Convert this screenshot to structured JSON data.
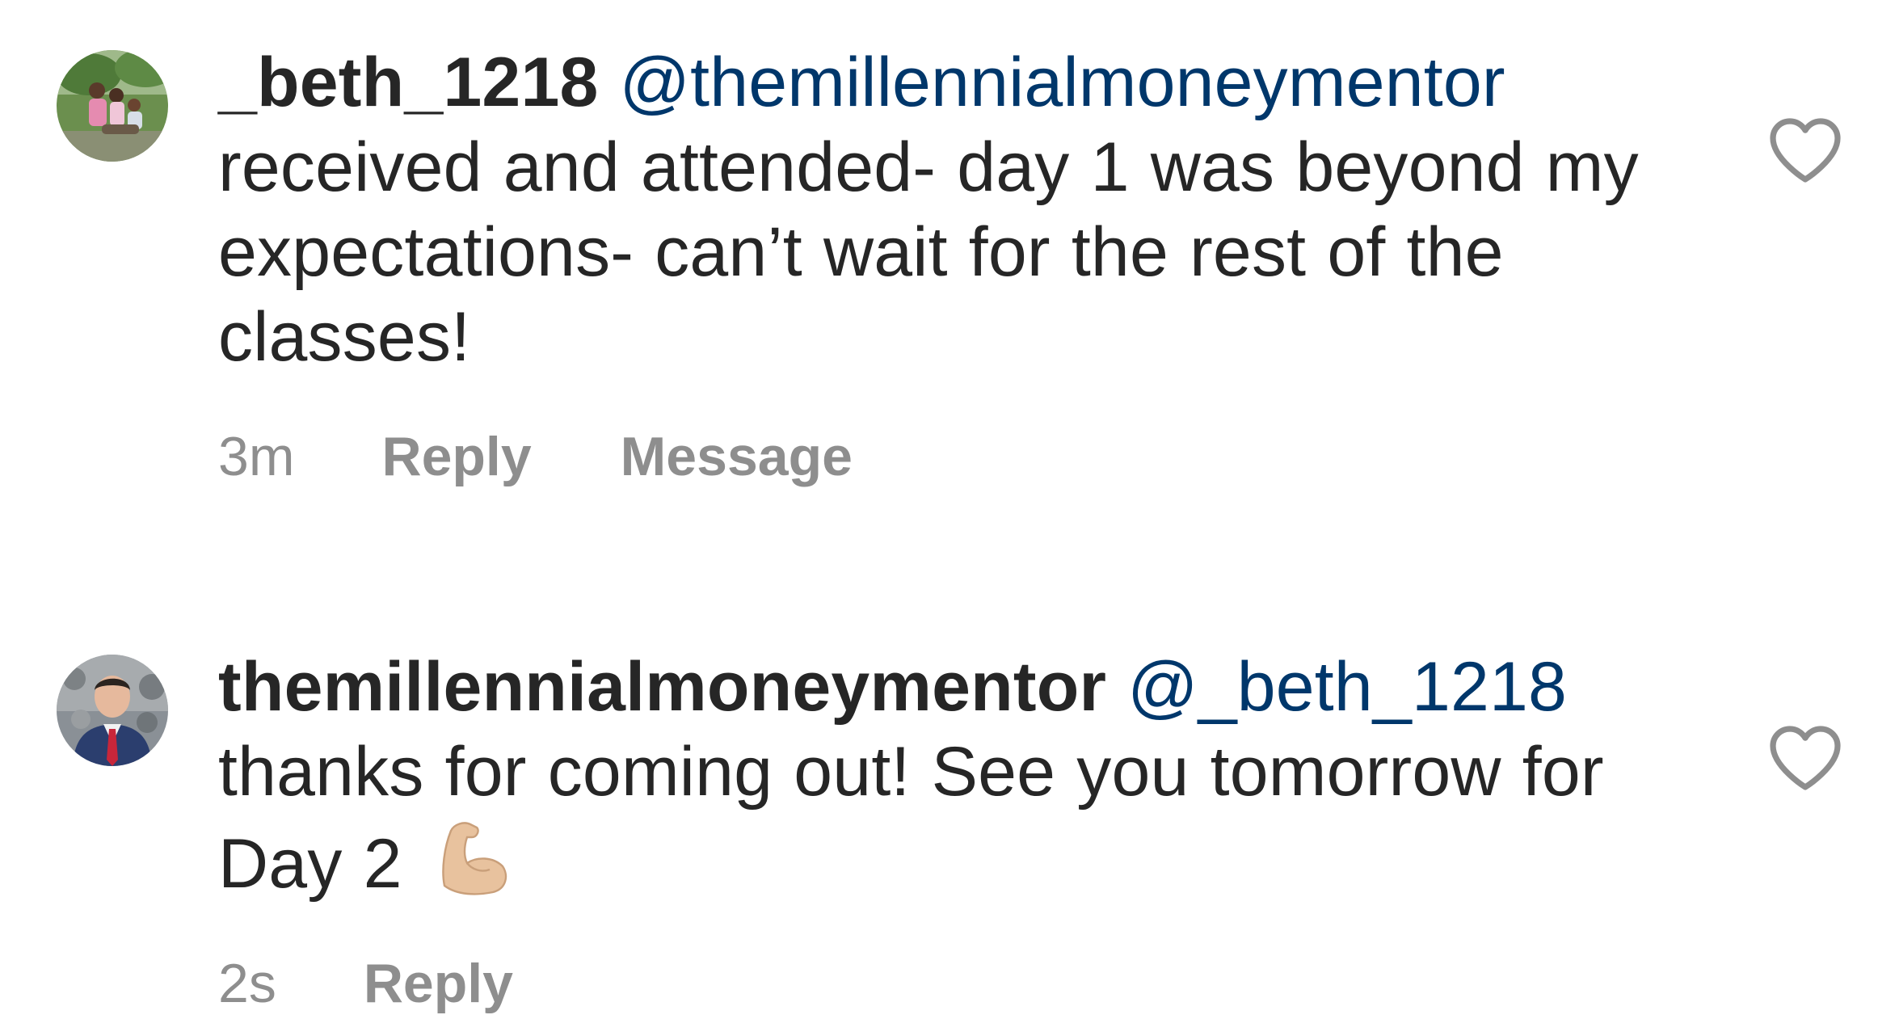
{
  "comments": [
    {
      "username": "_beth_1218",
      "mention": "@themillennialmoneymentor",
      "text": "received and attended- day 1 was beyond my expectations- can’t wait for the rest of the classes!",
      "time": "3m",
      "reply_label": "Reply",
      "message_label": "Message",
      "avatar_icon": "family-photo-avatar",
      "like_icon": "heart-outline-icon"
    },
    {
      "username": "themillennialmoneymentor",
      "mention": "@_beth_1218",
      "text": "thanks for coming out! See you tomorrow for Day 2",
      "emoji": "💪🏼",
      "emoji_icon": "flexed-biceps-icon",
      "time": "2s",
      "reply_label": "Reply",
      "avatar_icon": "man-in-suit-avatar",
      "like_icon": "heart-outline-icon"
    }
  ],
  "colors": {
    "text": "#262626",
    "mention": "#00376b",
    "meta": "#8e8e8e"
  }
}
